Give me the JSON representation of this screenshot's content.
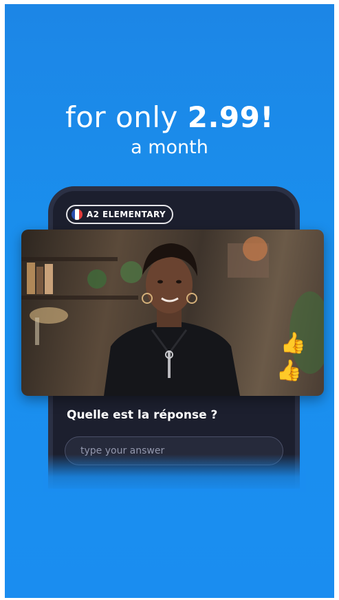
{
  "promo": {
    "line1_lead": "for only ",
    "line1_price": "2.99!",
    "line2": "a month"
  },
  "lesson": {
    "level_badge": "A2 ELEMENTARY",
    "flag": "france-flag-icon",
    "reactions": [
      "👍",
      "👍"
    ],
    "question": "Quelle est la réponse ?",
    "answer_placeholder": "type your answer"
  },
  "colors": {
    "background_blue": "#1a8df0",
    "phone_dark": "#1c1f2e",
    "text_white": "#ffffff"
  }
}
